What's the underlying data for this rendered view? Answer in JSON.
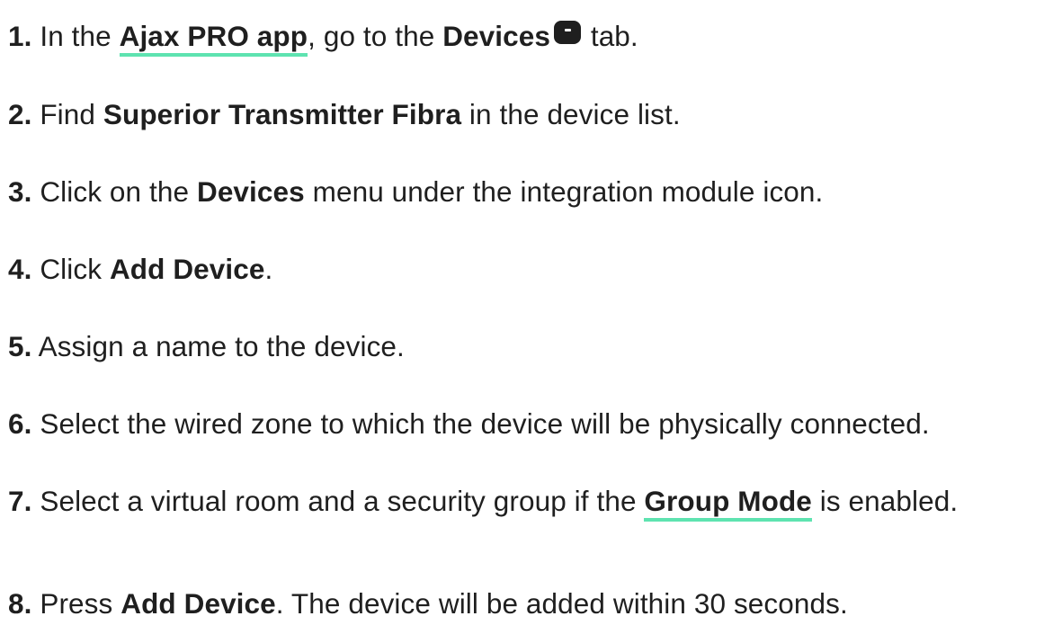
{
  "steps": [
    {
      "num": "1.",
      "t1": " In the ",
      "link": "Ajax PRO app",
      "t2": ", go to the ",
      "b1": "Devices",
      "icon": "devices-tab-icon",
      "t3": " tab."
    },
    {
      "num": "2.",
      "t1": " Find ",
      "b1": "Superior Transmitter Fibra",
      "t2": " in the device list."
    },
    {
      "num": "3.",
      "t1": " Click on the ",
      "b1": "Devices",
      "t2": " menu under the integration module icon."
    },
    {
      "num": "4.",
      "t1": " Click ",
      "b1": "Add Device",
      "t2": "."
    },
    {
      "num": "5.",
      "t1": " Assign a name to the device."
    },
    {
      "num": "6.",
      "t1": " Select the wired zone to which the device will be physically connected."
    },
    {
      "num": "7.",
      "t1": " Select a virtual room and a security group if the ",
      "link": "Group Mode",
      "t2": " is enabled."
    },
    {
      "num": "8.",
      "t1": " Press ",
      "b1": "Add Device",
      "t2": ". The device will be added within 30 seconds."
    }
  ],
  "colors": {
    "text": "#1f1f1f",
    "link_underline": "#5ee3b0",
    "background": "#ffffff"
  }
}
